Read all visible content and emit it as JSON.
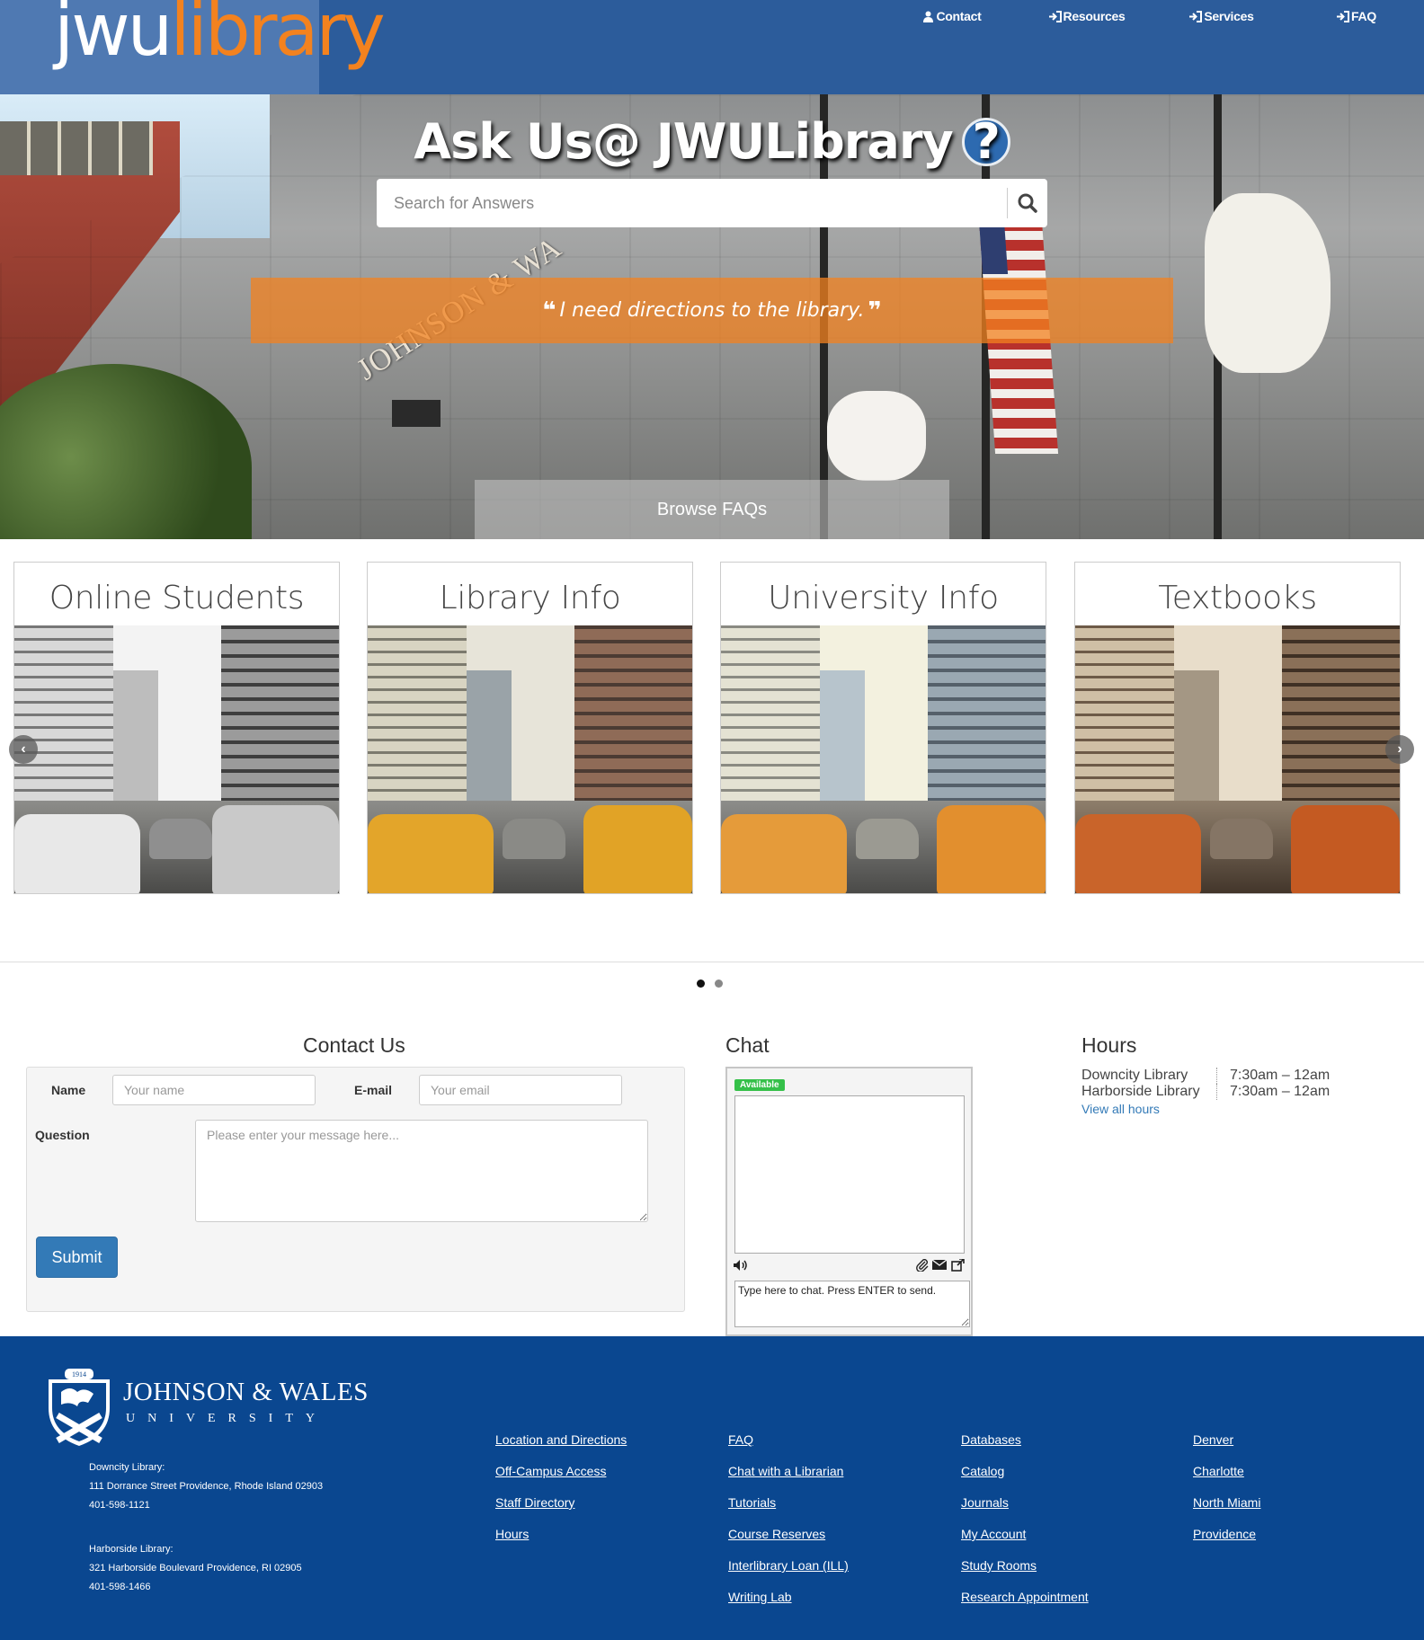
{
  "header": {
    "logo_part1": "jwu",
    "logo_part2": "library",
    "nav": [
      {
        "label": "Contact",
        "icon": "user-icon"
      },
      {
        "label": "Resources",
        "icon": "sign-in-icon"
      },
      {
        "label": "Services",
        "icon": "sign-in-icon"
      },
      {
        "label": "FAQ",
        "icon": "sign-in-icon"
      }
    ]
  },
  "hero": {
    "title": "Ask Us@ JWULibrary",
    "help_glyph": "?",
    "search_placeholder": "Search for Answers",
    "quote": "I need directions to the library.",
    "browse_label": "Browse FAQs",
    "building_lettering": "JOHNSON & WA"
  },
  "carousel": {
    "cards": [
      {
        "title": "Online Students",
        "tone": "grayscale"
      },
      {
        "title": "Library Info",
        "tone": "warm"
      },
      {
        "title": "University Info",
        "tone": "light"
      },
      {
        "title": "Textbooks",
        "tone": "sepia"
      }
    ],
    "prev_icon": "chevron-left-icon",
    "next_icon": "chevron-right-icon",
    "pages": 2,
    "active_page": 1
  },
  "contact": {
    "heading": "Contact Us",
    "name_label": "Name",
    "name_placeholder": "Your name",
    "email_label": "E-mail",
    "email_placeholder": "Your email",
    "question_label": "Question",
    "question_placeholder": "Please enter your message here...",
    "submit_label": "Submit"
  },
  "chat": {
    "heading": "Chat",
    "status": "Available",
    "input_text": "Type here to chat. Press ENTER to send."
  },
  "hours": {
    "heading": "Hours",
    "rows": [
      {
        "name": "Downcity Library",
        "time": "7:30am – 12am"
      },
      {
        "name": "Harborside Library",
        "time": "7:30am – 12am"
      }
    ],
    "link": "View all hours"
  },
  "footer": {
    "university": "JOHNSON & WALES",
    "university_sub": "UNIVERSITY",
    "crest_year": "1914",
    "downcity": {
      "label": "Downcity Library:",
      "address": "111 Dorrance Street Providence, Rhode Island 02903",
      "phone": "401-598-1121"
    },
    "harborside": {
      "label": "Harborside Library:",
      "address": "321 Harborside Boulevard Providence, RI 02905",
      "phone": "401-598-1466"
    },
    "col1": [
      "Location and Directions",
      "Off-Campus Access",
      "Staff Directory",
      "Hours"
    ],
    "col2": [
      "FAQ",
      "Chat with a Librarian",
      "Tutorials",
      "Course Reserves",
      "Interlibrary Loan (ILL)",
      "Writing Lab"
    ],
    "col3": [
      "Databases",
      "Catalog",
      "Journals",
      "My Account",
      "Study Rooms",
      "Research Appointment"
    ],
    "col4": [
      "Denver",
      "Charlotte",
      "North Miami",
      "Providence"
    ]
  },
  "colors": {
    "header_blue": "#2c5c9b",
    "footer_blue": "#0a4790",
    "accent_orange": "#f3821f",
    "button_blue": "#337ab7",
    "available_green": "#35c049"
  }
}
